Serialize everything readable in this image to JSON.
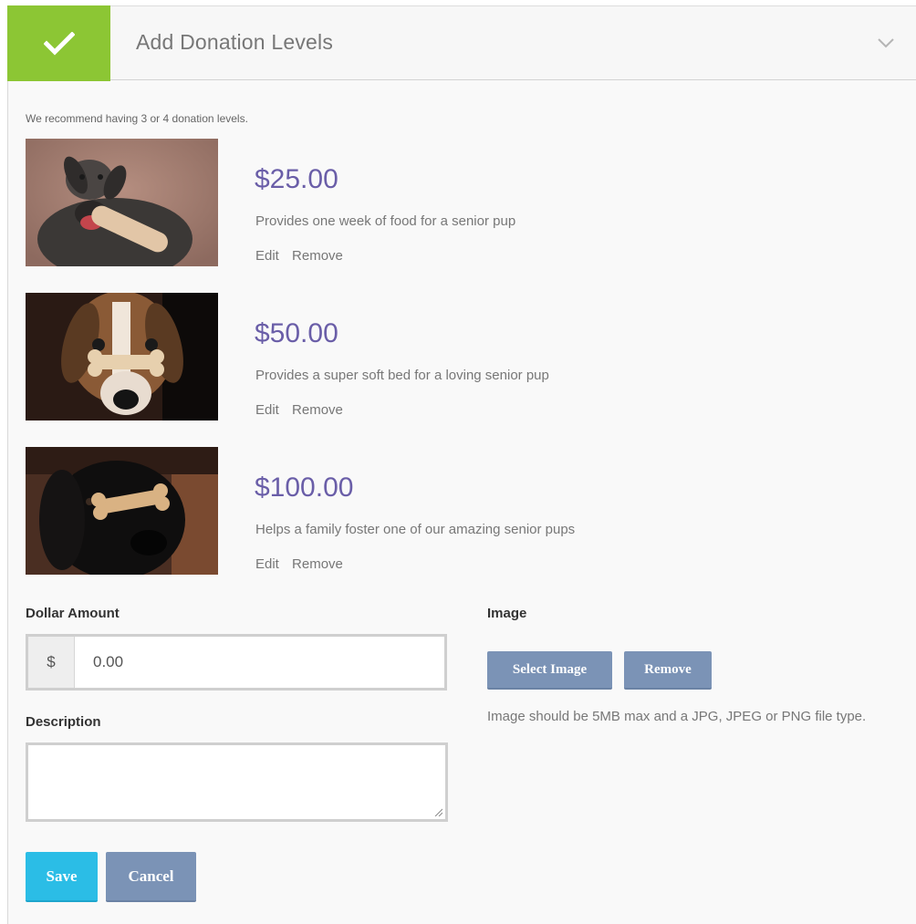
{
  "header": {
    "title": "Add Donation Levels",
    "accent_color": "#8cc634"
  },
  "recommendation": "We recommend having 3 or 4 donation levels.",
  "levels": [
    {
      "amount": "$25.00",
      "description": "Provides one week of food for a senior pup",
      "edit_label": "Edit",
      "remove_label": "Remove"
    },
    {
      "amount": "$50.00",
      "description": "Provides a super soft bed for a loving senior pup",
      "edit_label": "Edit",
      "remove_label": "Remove"
    },
    {
      "amount": "$100.00",
      "description": "Helps a family foster one of our amazing senior pups",
      "edit_label": "Edit",
      "remove_label": "Remove"
    }
  ],
  "form": {
    "dollar_label": "Dollar Amount",
    "currency_symbol": "$",
    "dollar_value": "0.00",
    "description_label": "Description",
    "description_value": "",
    "image_label": "Image",
    "select_image_label": "Select Image",
    "remove_image_label": "Remove",
    "image_hint": "Image should be 5MB max and a JPG, JPEG or PNG file type.",
    "save_label": "Save",
    "cancel_label": "Cancel"
  },
  "colors": {
    "amount": "#6a5ea8",
    "primary_button": "#2bbde6",
    "secondary_button": "#7b93b6"
  }
}
